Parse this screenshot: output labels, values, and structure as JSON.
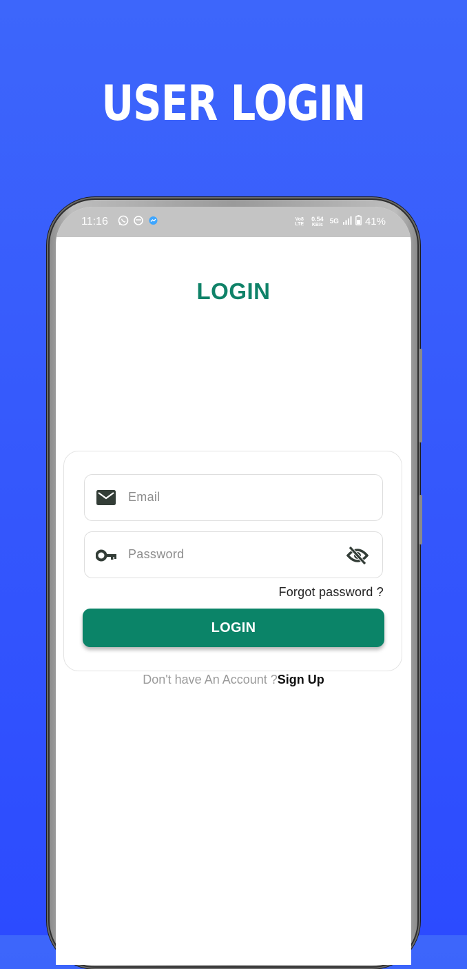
{
  "headline": "USER LOGIN",
  "status_bar": {
    "time": "11:16",
    "volte_top": "Vo8",
    "volte_bottom": "LTE",
    "speed_value": "0.54",
    "speed_unit": "KB/s",
    "network": "5G",
    "battery": "41%",
    "icons": [
      "whatsapp-icon",
      "app-icon",
      "messenger-icon",
      "signal-icon",
      "battery-icon"
    ]
  },
  "screen": {
    "title": "LOGIN",
    "email_placeholder": "Email",
    "password_placeholder": "Password",
    "forgot_password": "Forgot password ?",
    "login_button": "LOGIN",
    "signup_prompt": "Don't have An Account ?",
    "signup_link": "Sign Up"
  },
  "colors": {
    "background": "#3558fc",
    "accent": "#0b8468",
    "title": "#0f8268"
  }
}
